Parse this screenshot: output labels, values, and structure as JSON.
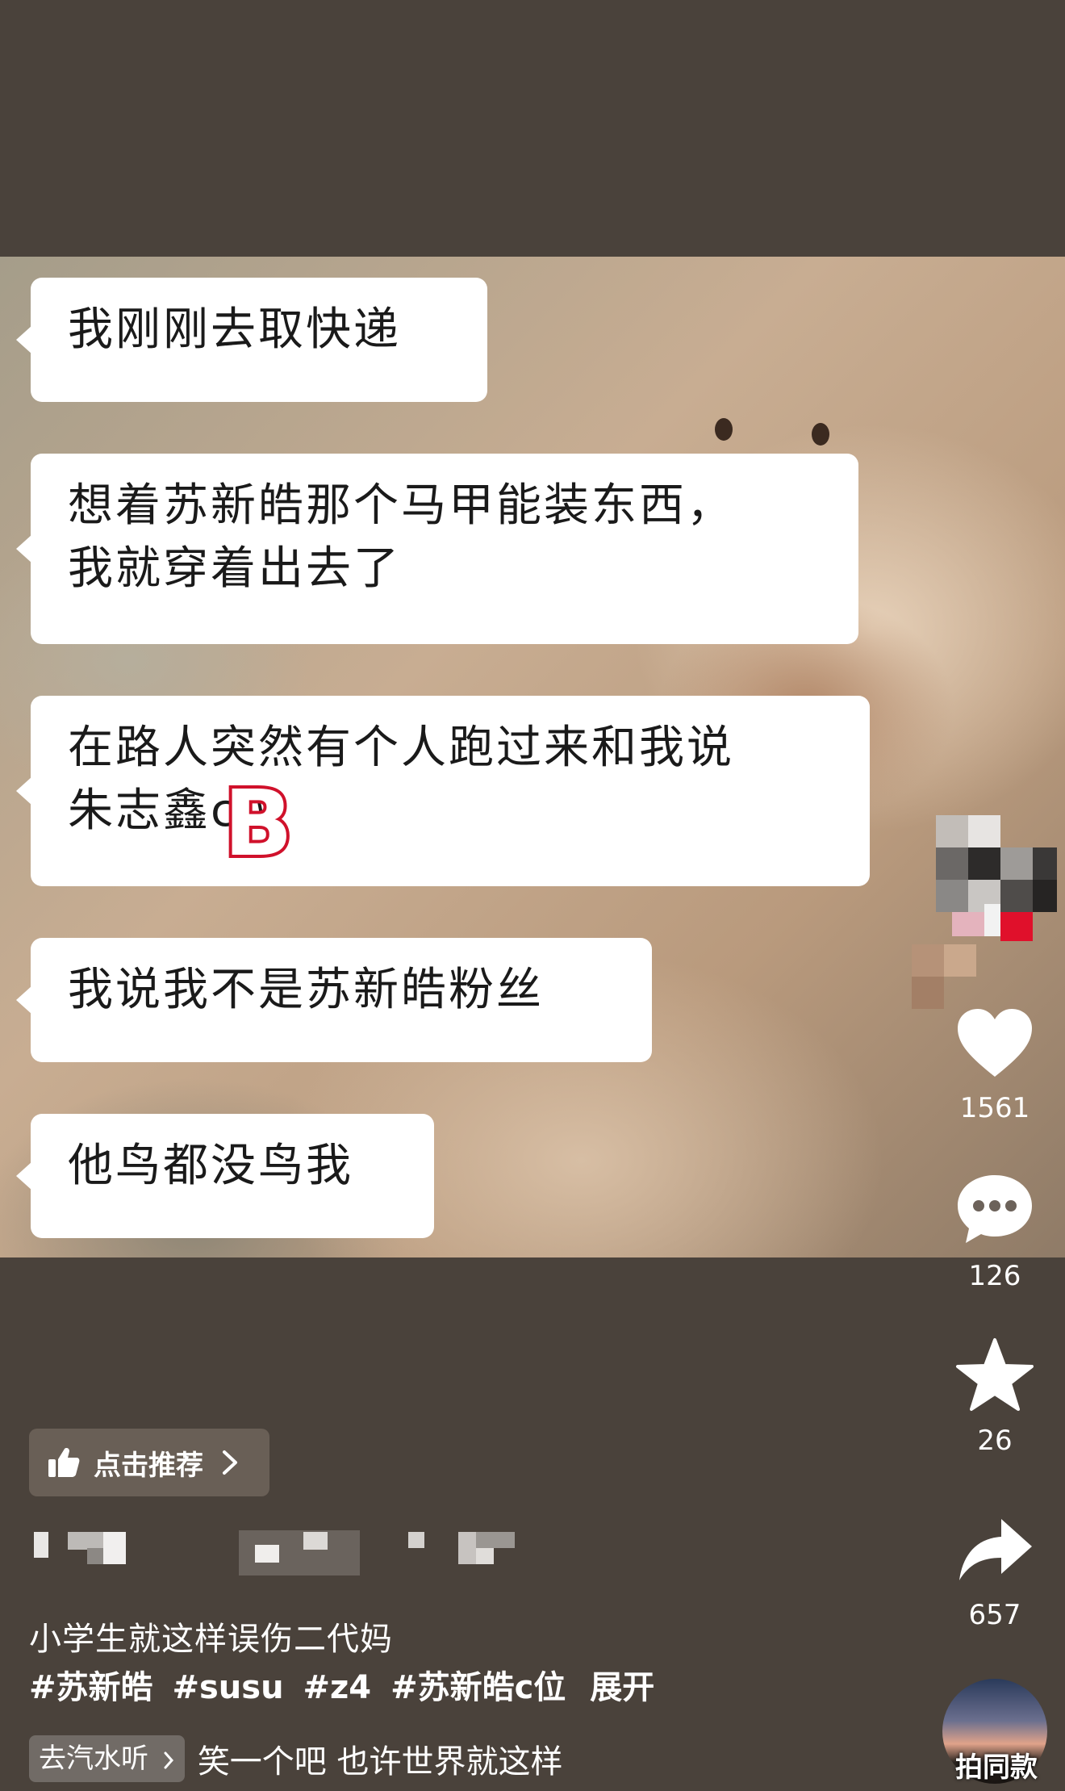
{
  "chat_messages": [
    {
      "lines": [
        "我刚刚去取快递"
      ]
    },
    {
      "lines": [
        "想着苏新皓那个马甲能装东西，",
        "我就穿着出去了"
      ]
    },
    {
      "lines": [
        "在路人突然有个人跑过来和我说",
        "朱志鑫c位"
      ]
    },
    {
      "lines": [
        "我说我不是苏新皓粉丝"
      ]
    },
    {
      "lines": [
        "他鸟都没鸟我"
      ]
    }
  ],
  "overlay_logo": "B",
  "actions": {
    "like_count": "1561",
    "comment_count": "126",
    "favorite_count": "26",
    "share_count": "657"
  },
  "recommend_label": "点击推荐",
  "caption": "小学生就这样误伤二代妈",
  "hashtags": [
    "#苏新皓",
    "#susu",
    "#z4",
    "#苏新皓c位"
  ],
  "expand_label": "展开",
  "music": {
    "badge": "去汽水听",
    "title": "笑一个吧 也许世界就这样"
  },
  "avatar_label": "拍同款",
  "colors": {
    "background": "#4a423b",
    "bubble": "#ffffff",
    "logo_stroke": "#d0112b"
  }
}
